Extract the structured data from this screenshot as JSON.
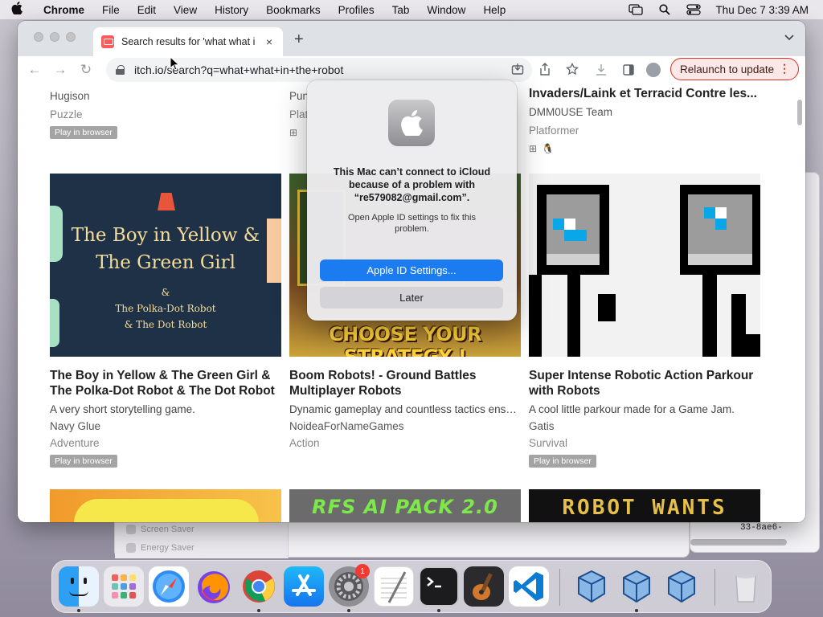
{
  "menubar": {
    "app": "Chrome",
    "items": [
      "File",
      "Edit",
      "View",
      "History",
      "Bookmarks",
      "Profiles",
      "Tab",
      "Window",
      "Help"
    ],
    "clock": "Thu Dec 7  3:39 AM"
  },
  "tab": {
    "title": "Search results for 'what what i",
    "close": "×"
  },
  "toolbar": {
    "url": "itch.io/search?q=what+what+in+the+robot",
    "relaunch_label": "Relaunch to update"
  },
  "top_row": [
    {
      "author": "Hugison",
      "genre": "Puzzle",
      "badge": "Play in browser"
    },
    {
      "author": "Pun",
      "genre": "Plat"
    },
    {
      "title": "Invaders/Laink et Terracid Contre les...",
      "author": "DMM0USE Team",
      "genre": "Platformer"
    }
  ],
  "games": [
    {
      "title": "The Boy in Yellow & The Green Girl & The Polka-Dot Robot & The Dot Robot",
      "desc": "A very short storytelling game.",
      "author": "Navy Glue",
      "genre": "Adventure",
      "badge": "Play in browser",
      "thumb_lines": [
        "The Boy in Yellow &",
        "The Green Girl",
        "&",
        "The Polka-Dot Robot",
        "& The Dot Robot"
      ]
    },
    {
      "title": "Boom Robots! - Ground Battles Multiplayer Robots",
      "desc": "Dynamic gameplay and countless tactics ensu...",
      "author": "NoideaForNameGames",
      "genre": "Action",
      "thumb_text": "CHOOSE YOUR STRATEGY !"
    },
    {
      "title": "Super Intense Robotic Action Parkour with Robots",
      "desc": "A cool little parkour made for a Game Jam.",
      "author": "Gatis",
      "genre": "Survival",
      "badge": "Play in browser"
    }
  ],
  "bottom_row": [
    {
      "thumb_text": ""
    },
    {
      "thumb_text": "RFS AI PACK 2.0"
    },
    {
      "thumb_text": "ROBOT WANTS"
    }
  ],
  "dialog": {
    "title": "This Mac can’t connect to iCloud because of a problem with “re579082@gmail.com”.",
    "message": "Open Apple ID settings to fix this problem.",
    "primary": "Apple ID Settings...",
    "secondary": "Later"
  },
  "bg_window": {
    "rows": [
      "Screen Saver",
      "Energy Saver"
    ],
    "code": "33-8ae6-"
  },
  "dock": {
    "settings_badge": "1"
  },
  "colors": {
    "accent": "#1a7cf0",
    "relaunch_border": "#d93025",
    "itch_red": "#fa5c5c"
  }
}
